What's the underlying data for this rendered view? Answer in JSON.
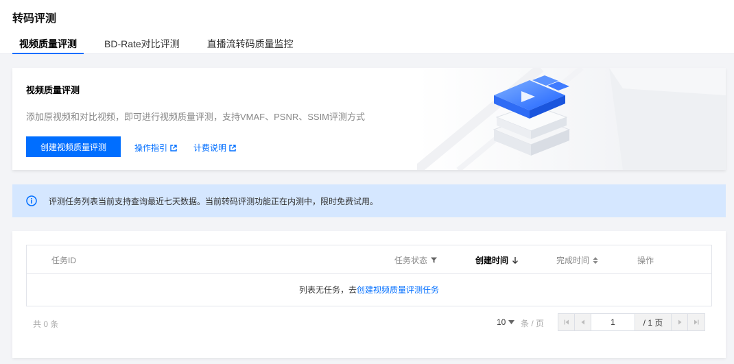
{
  "page": {
    "title": "转码评测"
  },
  "tabs": [
    {
      "label": "视频质量评测",
      "active": true
    },
    {
      "label": "BD-Rate对比评测",
      "active": false
    },
    {
      "label": "直播流转码质量监控",
      "active": false
    }
  ],
  "intro": {
    "title": "视频质量评测",
    "description": "添加原视频和对比视频，即可进行视频质量评测，支持VMAF、PSNR、SSIM评测方式",
    "create_button": "创建视频质量评测",
    "guide_link": "操作指引",
    "billing_link": "计费说明"
  },
  "notice": {
    "icon": "info-icon",
    "text": "评测任务列表当前支持查询最近七天数据。当前转码评测功能正在内测中，限时免费试用。"
  },
  "table": {
    "columns": [
      {
        "label": "任务ID"
      },
      {
        "label": "任务状态",
        "icon": "filter-icon"
      },
      {
        "label": "创建时间",
        "icon": "sort-down-icon"
      },
      {
        "label": "完成时间",
        "icon": "sort-icon"
      },
      {
        "label": "操作"
      }
    ],
    "empty_text": "列表无任务，去",
    "empty_link": "创建视频质量评测任务"
  },
  "pagination": {
    "total_text": "共 0 条",
    "page_size": "10",
    "per_page_label": "条 / 页",
    "current_page": "1",
    "total_pages": "/ 1 页"
  },
  "colors": {
    "accent": "#006eff",
    "notice_bg": "#d5e7ff",
    "page_bg": "#f3f4f7"
  }
}
